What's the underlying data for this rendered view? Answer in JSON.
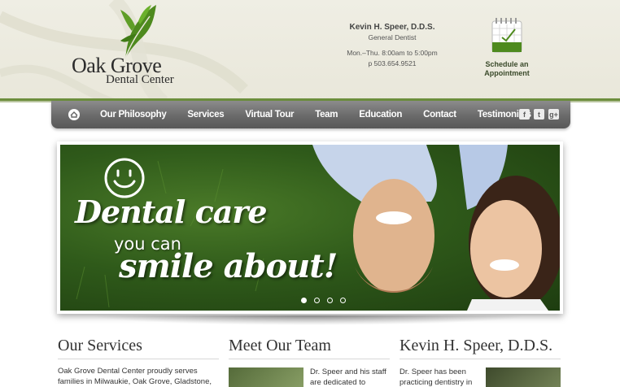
{
  "header": {
    "logo": {
      "line1": "Oak Grove",
      "line2": "Dental Center"
    },
    "contact": {
      "name": "Kevin H. Speer, D.D.S.",
      "title": "General Dentist",
      "hours": "Mon.–Thu. 8:00am to 5:00pm",
      "phone": "p 503.654.9521"
    },
    "schedule": {
      "line1": "Schedule an",
      "line2": "Appointment",
      "icon": "calendar-icon"
    }
  },
  "nav": {
    "home_icon": "home-icon",
    "items": [
      {
        "label": "Our Philosophy"
      },
      {
        "label": "Services"
      },
      {
        "label": "Virtual Tour"
      },
      {
        "label": "Team"
      },
      {
        "label": "Education"
      },
      {
        "label": "Contact"
      },
      {
        "label": "Testimonials"
      }
    ],
    "social": [
      {
        "icon": "facebook-icon",
        "glyph": "f"
      },
      {
        "icon": "twitter-icon",
        "glyph": "t"
      },
      {
        "icon": "google-plus-icon",
        "glyph": "g+"
      }
    ]
  },
  "hero": {
    "line1": "Dental care",
    "line2": "you can",
    "line3": "smile about!",
    "slides": 4,
    "active_slide": 1
  },
  "sections": {
    "services": {
      "title": "Our Services",
      "text": "Oak Grove Dental Center proudly serves families in Milwaukie, Oak Grove, Gladstone,"
    },
    "team": {
      "title": "Meet Our Team",
      "text": "Dr. Speer and his staff are dedicated to"
    },
    "doctor": {
      "title": "Kevin H. Speer, D.D.S.",
      "text": "Dr. Speer has been practicing dentistry in"
    }
  },
  "colors": {
    "accent": "#6d8e3d",
    "nav": "#6a6a6a",
    "header_bg": "#efeee4"
  }
}
